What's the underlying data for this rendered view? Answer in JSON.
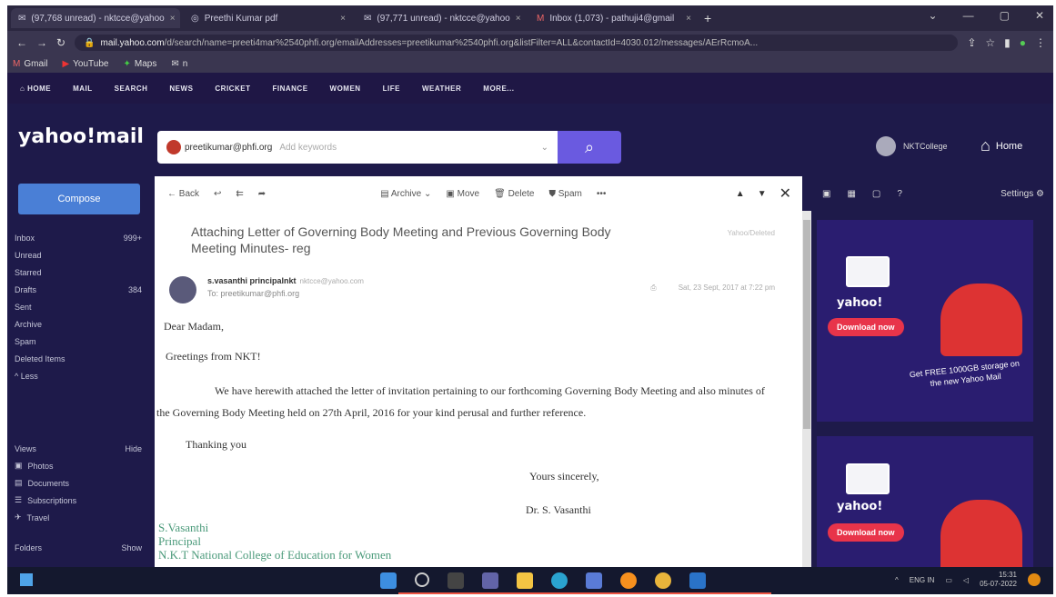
{
  "browser": {
    "tabs": [
      {
        "label": "(97,768 unread) - nktcce@yahoo"
      },
      {
        "label": "Preethi Kumar pdf"
      },
      {
        "label": "(97,771 unread) - nktcce@yahoo"
      },
      {
        "label": "Inbox (1,073) - pathuji4@gmail"
      }
    ],
    "new_tab": "+",
    "url_host": "mail.yahoo.com",
    "url_rest": "/d/search/name=preeti4mar%2540phfi.org/emailAddresses=preetikumar%2540phfi.org&listFilter=ALL&contactId=4030.012/messages/AErRcmoA...",
    "bookmarks": [
      {
        "label": "Gmail"
      },
      {
        "label": "YouTube"
      },
      {
        "label": "Maps"
      },
      {
        "label": "n"
      }
    ]
  },
  "yahoo_nav": [
    "HOME",
    "MAIL",
    "SEARCH",
    "NEWS",
    "CRICKET",
    "FINANCE",
    "WOMEN",
    "LIFE",
    "WEATHER",
    "MORE..."
  ],
  "header": {
    "logo": "yahoo!mail",
    "search_chip": "preetikumar@phfi.org",
    "search_placeholder": "Add keywords",
    "user": "NKTCollege",
    "home": "Home"
  },
  "sidebar": {
    "compose": "Compose",
    "folders": [
      {
        "label": "Inbox",
        "count": "999+"
      },
      {
        "label": "Unread",
        "count": ""
      },
      {
        "label": "Starred",
        "count": ""
      },
      {
        "label": "Drafts",
        "count": "384"
      },
      {
        "label": "Sent",
        "count": ""
      },
      {
        "label": "Archive",
        "count": ""
      },
      {
        "label": "Spam",
        "count": ""
      },
      {
        "label": "Deleted Items",
        "count": ""
      },
      {
        "label": "^ Less",
        "count": ""
      }
    ],
    "views_label": "Views",
    "views_hide": "Hide",
    "views": [
      {
        "label": "Photos"
      },
      {
        "label": "Documents"
      },
      {
        "label": "Subscriptions"
      },
      {
        "label": "Travel"
      }
    ],
    "folders_label": "Folders",
    "folders_show": "Show"
  },
  "toolbar": {
    "back": "Back",
    "archive": "Archive",
    "move": "Move",
    "delete": "Delete",
    "spam": "Spam",
    "more": "•••"
  },
  "message": {
    "subject": "Attaching Letter of Governing Body Meeting and Previous Governing Body Meeting Minutes- reg",
    "folder": "Yahoo/Deleted",
    "sender_name": "s.vasanthi principalnkt",
    "sender_email": "nktcce@yahoo.com",
    "to": "To: preetikumar@phfi.org",
    "date": "Sat, 23 Sept, 2017 at 7:22 pm",
    "salutation": "Dear Madam,",
    "greeting": "Greetings from NKT!",
    "para1": "We have herewith attached the letter of invitation pertaining to our forthcoming Governing Body Meeting and also minutes of the Governing Body Meeting held on 27th April, 2016 for your kind perusal and further reference.",
    "thanks": "Thanking you",
    "closing": "Yours sincerely,",
    "signer": "Dr. S. Vasanthi",
    "sig_name": "S.Vasanthi",
    "sig_title": "Principal",
    "sig_org": "N.K.T National College of Education for Women"
  },
  "right_panel": {
    "settings": "Settings"
  },
  "ads": [
    {
      "brand": "yahoo!",
      "cta": "Download now",
      "text": "Get FREE 1000GB storage on the new Yahoo Mail"
    },
    {
      "brand": "yahoo!",
      "cta": "Download now"
    }
  ],
  "taskbar": {
    "tray_lang": "ENG IN",
    "time": "15:31",
    "date": "05-07-2022"
  }
}
